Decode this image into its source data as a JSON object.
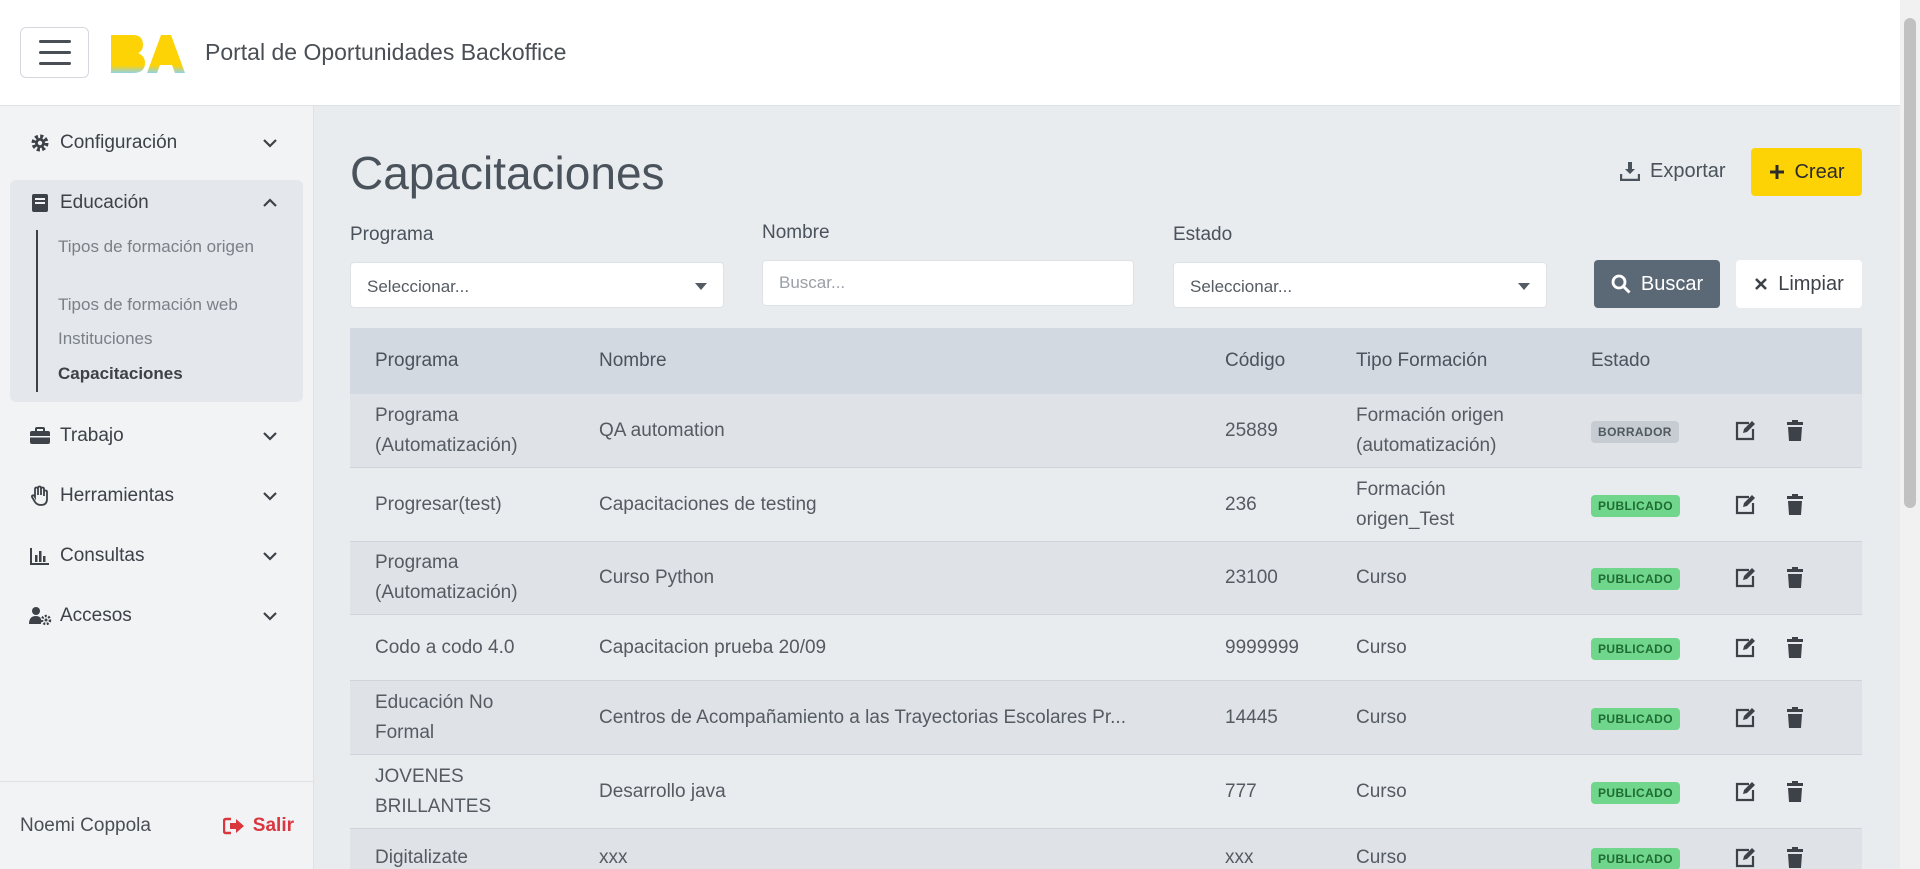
{
  "header": {
    "title": "Portal de Oportunidades Backoffice",
    "logo_text": "BA"
  },
  "sidebar": {
    "items": [
      {
        "label": "Configuración",
        "icon": "gear-icon"
      },
      {
        "label": "Educación",
        "icon": "book-icon"
      },
      {
        "label": "Trabajo",
        "icon": "briefcase-icon"
      },
      {
        "label": "Herramientas",
        "icon": "hand-icon"
      },
      {
        "label": "Consultas",
        "icon": "chart-icon"
      },
      {
        "label": "Accesos",
        "icon": "users-cog-icon"
      }
    ],
    "education_sub": [
      "Tipos de formación origen",
      "Tipos de formación web",
      "Instituciones",
      "Capacitaciones"
    ],
    "active_sub": "Capacitaciones",
    "user_name": "Noemi Coppola",
    "logout_label": "Salir"
  },
  "page": {
    "title": "Capacitaciones",
    "export_label": "Exportar",
    "create_label": "Crear"
  },
  "filters": {
    "programa_label": "Programa",
    "programa_value": "Seleccionar...",
    "nombre_label": "Nombre",
    "nombre_placeholder": "Buscar...",
    "estado_label": "Estado",
    "estado_value": "Seleccionar...",
    "search_label": "Buscar",
    "clear_label": "Limpiar"
  },
  "table": {
    "headers": [
      "Programa",
      "Nombre",
      "Código",
      "Tipo Formación",
      "Estado"
    ],
    "rows": [
      {
        "programa": [
          "Programa",
          "(Automatización)"
        ],
        "nombre": "QA automation",
        "codigo": "25889",
        "tipo": [
          "Formación origen",
          "(automatización)"
        ],
        "estado": "BORRADOR"
      },
      {
        "programa": [
          "Progresar(test)"
        ],
        "nombre": "Capacitaciones de testing",
        "codigo": "236",
        "tipo": [
          "Formación",
          "origen_Test"
        ],
        "estado": "PUBLICADO"
      },
      {
        "programa": [
          "Programa",
          "(Automatización)"
        ],
        "nombre": "Curso Python",
        "codigo": "23100",
        "tipo": [
          "Curso"
        ],
        "estado": "PUBLICADO"
      },
      {
        "programa": [
          "Codo a codo 4.0"
        ],
        "nombre": "Capacitacion prueba 20/09",
        "codigo": "9999999",
        "tipo": [
          "Curso"
        ],
        "estado": "PUBLICADO"
      },
      {
        "programa": [
          "Educación No",
          "Formal"
        ],
        "nombre": "Centros de Acompañamiento a las Trayectorias Escolares Pr...",
        "codigo": "14445",
        "tipo": [
          "Curso"
        ],
        "estado": "PUBLICADO"
      },
      {
        "programa": [
          "JOVENES",
          "BRILLANTES"
        ],
        "nombre": "Desarrollo java",
        "codigo": "777",
        "tipo": [
          "Curso"
        ],
        "estado": "PUBLICADO"
      },
      {
        "programa": [
          "Digitalizate"
        ],
        "nombre": "xxx",
        "codigo": "xxx",
        "tipo": [
          "Curso"
        ],
        "estado": "PUBLICADO"
      }
    ]
  },
  "colors": {
    "accent": "#fdd306",
    "search_button": "#5b6876",
    "published": "#6fd68b",
    "draft": "#c6ccd2",
    "logout": "#d9363e"
  }
}
